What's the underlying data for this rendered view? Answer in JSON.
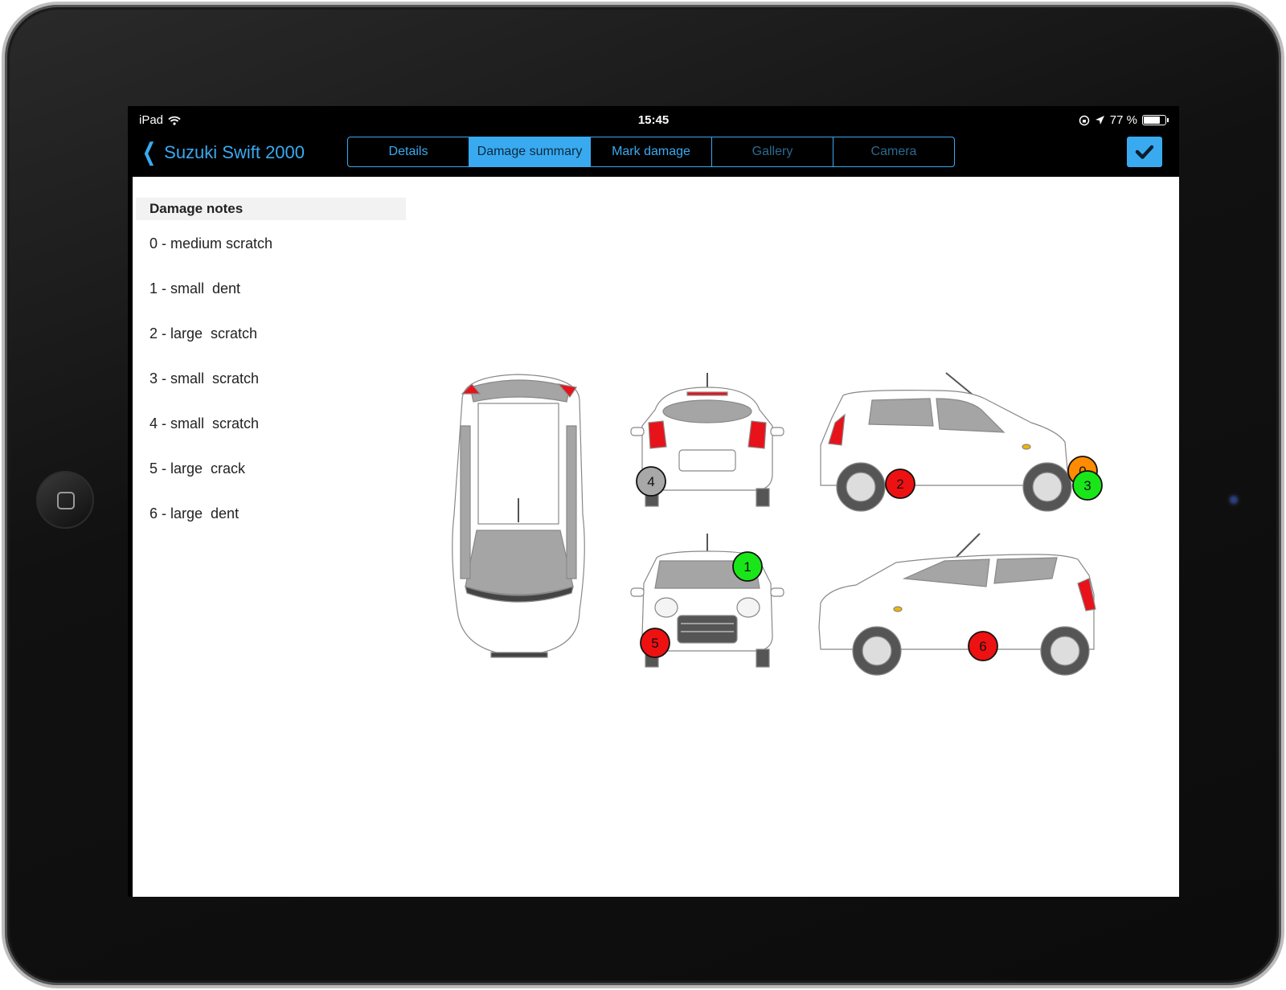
{
  "status_bar": {
    "device": "iPad",
    "time": "15:45",
    "battery": "77 %",
    "battery_level": 0.77
  },
  "nav": {
    "back_label": "Suzuki Swift 2000",
    "tabs": [
      {
        "label": "Details",
        "state": "enabled"
      },
      {
        "label": "Damage summary",
        "state": "active"
      },
      {
        "label": "Mark damage",
        "state": "enabled"
      },
      {
        "label": "Gallery",
        "state": "disabled"
      },
      {
        "label": "Camera",
        "state": "disabled"
      }
    ]
  },
  "damage_notes": {
    "title": "Damage notes",
    "items": [
      "0 - medium scratch",
      "1 - small  dent",
      "2 - large  scratch",
      "3 - small  scratch",
      "4 - small  scratch",
      "5 - large  crack",
      "6 - large  dent"
    ]
  },
  "markers": [
    {
      "label": "0",
      "color": "#ff8c00",
      "view": "left-side"
    },
    {
      "label": "1",
      "color": "#19e619",
      "view": "front"
    },
    {
      "label": "2",
      "color": "#ee1111",
      "view": "left-side"
    },
    {
      "label": "3",
      "color": "#19e619",
      "view": "left-side"
    },
    {
      "label": "4",
      "color": "#a8a8a8",
      "view": "rear"
    },
    {
      "label": "5",
      "color": "#ee1111",
      "view": "front"
    },
    {
      "label": "6",
      "color": "#ee1111",
      "view": "right-side"
    }
  ],
  "colors": {
    "accent": "#3aaaf0",
    "car_body": "#ffffff",
    "glass": "#a5a5a5",
    "light": "#e8121a"
  },
  "icons": {
    "back": "chevron-left-icon",
    "done": "checkmark-icon",
    "wifi": "wifi-icon",
    "location": "location-arrow-icon",
    "rotation_lock": "rotation-lock-icon",
    "battery": "battery-icon"
  }
}
